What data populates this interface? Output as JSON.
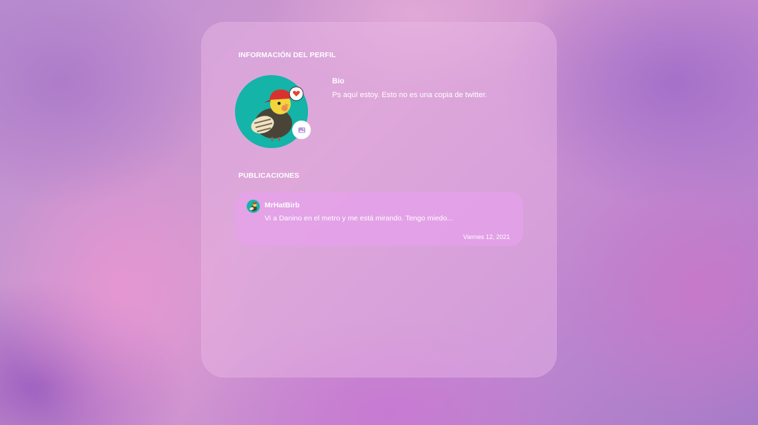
{
  "profile": {
    "section_title": "INFORMACIÓN DEL PERFIL",
    "bio_label": "Bio",
    "bio_text": "Ps aquí estoy. Esto no es una copia de twitter."
  },
  "posts": {
    "section_title": "PUBLICACIONES",
    "items": [
      {
        "username": "MrHatBirb",
        "text": "Vi a Danino en el metro y me está mirando. Tengo miedo...",
        "date": "Viernes 12, 2021"
      }
    ]
  },
  "icons": {
    "avatar": "cockatiel-with-red-cap-avatar",
    "heart_bubble": "heart-speech-bubble-icon",
    "edit_image": "image-edit-icon"
  },
  "colors": {
    "avatar_background": "#14b4a8",
    "cap": "#d8322e",
    "edit_icon": "#b79ad8"
  }
}
